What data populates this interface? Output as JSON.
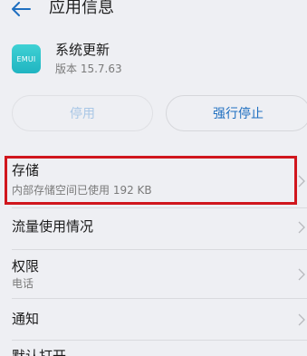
{
  "header": {
    "title": "应用信息",
    "back_icon": "back-arrow-icon"
  },
  "app": {
    "icon_text": "EMUI",
    "icon_color": "#2cc3cb",
    "name": "系统更新",
    "version": "版本 15.7.63"
  },
  "actions": {
    "disable_label": "停用",
    "force_stop_label": "强行停止"
  },
  "list": [
    {
      "title": "存储",
      "subtitle": "内部存储空间已使用 192 KB"
    },
    {
      "title": "流量使用情况",
      "subtitle": ""
    },
    {
      "title": "权限",
      "subtitle": "电话"
    },
    {
      "title": "通知",
      "subtitle": ""
    },
    {
      "title": "默认打开",
      "subtitle": ""
    }
  ],
  "colors": {
    "accent": "#1f6fc0",
    "highlight": "#d0161d",
    "background": "#eeeff3"
  }
}
